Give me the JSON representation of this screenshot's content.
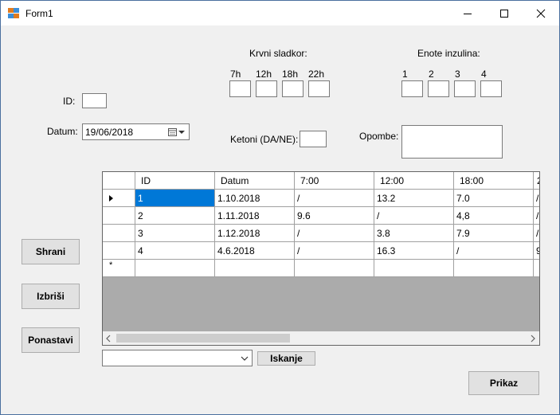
{
  "window": {
    "title": "Form1"
  },
  "labels": {
    "krvni_sladkor": "Krvni sladkor:",
    "enote_inzulina": "Enote inzulina:",
    "id": "ID:",
    "datum": "Datum:",
    "ketoni": "Ketoni (DA/NE):",
    "opombe": "Opombe:"
  },
  "sugar_times": [
    "7h",
    "12h",
    "18h",
    "22h"
  ],
  "insulin_units": [
    "1",
    "2",
    "3",
    "4"
  ],
  "fields": {
    "id_value": "",
    "datum_value": "19/06/2018",
    "ketoni_value": "",
    "opombe_value": ""
  },
  "buttons": {
    "shrani": "Shrani",
    "izbrisi": "Izbriši",
    "ponastavi": "Ponastavi",
    "iskanje": "Iskanje",
    "prikaz": "Prikaz"
  },
  "table": {
    "columns": [
      "ID",
      "Datum",
      "7:00",
      "12:00",
      "18:00",
      "2"
    ],
    "rows": [
      [
        "1",
        "1.10.2018",
        "/",
        "13.2",
        "7.0",
        "/"
      ],
      [
        "2",
        "1.11.2018",
        "9.6",
        "/",
        "4,8",
        "/"
      ],
      [
        "3",
        "1.12.2018",
        "/",
        "3.8",
        "7.9",
        "/"
      ],
      [
        "4",
        "4.6.2018",
        "/",
        "16.3",
        "/",
        "9"
      ]
    ],
    "new_row_marker": "*"
  },
  "search_combo": {
    "value": ""
  }
}
